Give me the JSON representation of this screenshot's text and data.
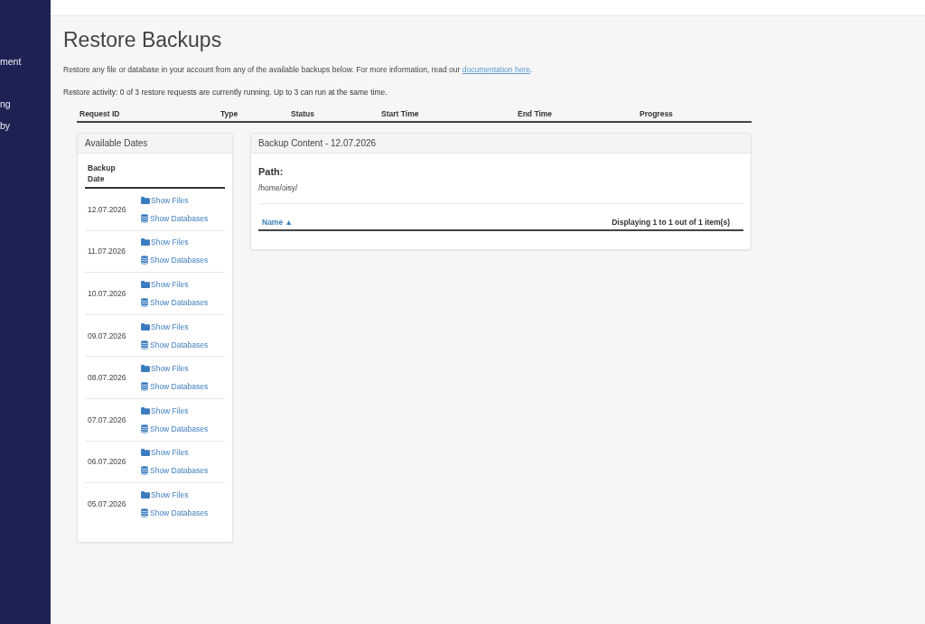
{
  "sidebar": {
    "items": [
      {
        "label": "ment"
      },
      {
        "label": "ng"
      },
      {
        "label": "by"
      }
    ]
  },
  "title": "Restore Backups",
  "intro": {
    "text": "Restore any file or database in your account from any of the available backups below. For more information, read our",
    "link": "documentation here",
    "end": "."
  },
  "activity": "Restore activity: 0 of 3 restore requests are currently running. Up to 3 can run at the same time.",
  "restore_requests": {
    "columns": [
      "Request ID",
      "Type",
      "Status",
      "Start Time",
      "End Time",
      "Progress"
    ]
  },
  "available_dates": {
    "title": "Available Dates",
    "column": "Backup Date",
    "rows": [
      {
        "date": "12.07.2026",
        "actions": [
          {
            "kind": "files",
            "label": "Show Files"
          },
          {
            "kind": "databases",
            "label": "Show Databases"
          }
        ]
      },
      {
        "date": "11.07.2026",
        "actions": [
          {
            "kind": "files",
            "label": "Show Files"
          },
          {
            "kind": "databases",
            "label": "Show Databases"
          }
        ]
      },
      {
        "date": "10.07.2026",
        "actions": [
          {
            "kind": "files",
            "label": "Show Files"
          },
          {
            "kind": "databases",
            "label": "Show Databases"
          }
        ]
      },
      {
        "date": "09.07.2026",
        "actions": [
          {
            "kind": "files",
            "label": "Show Files"
          },
          {
            "kind": "databases",
            "label": "Show Databases"
          }
        ]
      },
      {
        "date": "08.07.2026",
        "actions": [
          {
            "kind": "files",
            "label": "Show Files"
          },
          {
            "kind": "databases",
            "label": "Show Databases"
          }
        ]
      },
      {
        "date": "07.07.2026",
        "actions": [
          {
            "kind": "files",
            "label": "Show Files"
          },
          {
            "kind": "databases",
            "label": "Show Databases"
          }
        ]
      },
      {
        "date": "06.07.2026",
        "actions": [
          {
            "kind": "files",
            "label": "Show Files"
          },
          {
            "kind": "databases",
            "label": "Show Databases"
          }
        ]
      },
      {
        "date": "05.07.2026",
        "actions": [
          {
            "kind": "files",
            "label": "Show Files"
          },
          {
            "kind": "databases",
            "label": "Show Databases"
          }
        ]
      }
    ]
  },
  "backup_content": {
    "title": "Backup Content - 12.07.2026",
    "path_label": "Path:",
    "path": "/home/oisy/",
    "sort_column": "Name ▲",
    "summary": "Displaying 1 to 1 out of 1 item(s)"
  }
}
